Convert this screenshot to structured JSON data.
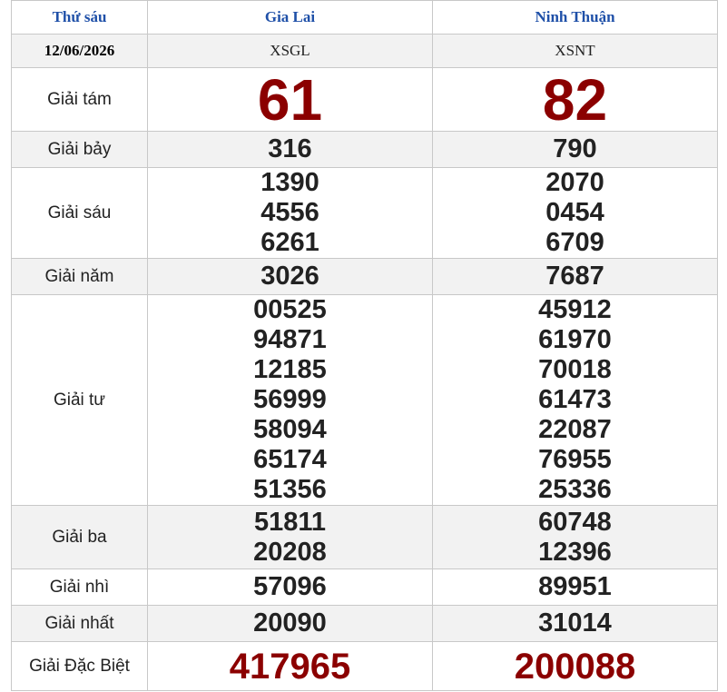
{
  "header": {
    "day": "Thứ sáu",
    "province_1": "Gia Lai",
    "province_2": "Ninh Thuận"
  },
  "subheader": {
    "date": "12/06/2026",
    "code_1": "XSGL",
    "code_2": "XSNT"
  },
  "prizes": [
    {
      "label": "Giải tám",
      "col1": [
        "61"
      ],
      "col2": [
        "82"
      ]
    },
    {
      "label": "Giải bảy",
      "col1": [
        "316"
      ],
      "col2": [
        "790"
      ]
    },
    {
      "label": "Giải sáu",
      "col1": [
        "1390",
        "4556",
        "6261"
      ],
      "col2": [
        "2070",
        "0454",
        "6709"
      ]
    },
    {
      "label": "Giải năm",
      "col1": [
        "3026"
      ],
      "col2": [
        "7687"
      ]
    },
    {
      "label": "Giải tư",
      "col1": [
        "00525",
        "94871",
        "12185",
        "56999",
        "58094",
        "65174",
        "51356"
      ],
      "col2": [
        "45912",
        "61970",
        "70018",
        "61473",
        "22087",
        "76955",
        "25336"
      ]
    },
    {
      "label": "Giải ba",
      "col1": [
        "51811",
        "20208"
      ],
      "col2": [
        "60748",
        "12396"
      ]
    },
    {
      "label": "Giải nhì",
      "col1": [
        "57096"
      ],
      "col2": [
        "89951"
      ]
    },
    {
      "label": "Giải nhất",
      "col1": [
        "20090"
      ],
      "col2": [
        "31014"
      ]
    },
    {
      "label": "Giải Đặc Biệt",
      "col1": [
        "417965"
      ],
      "col2": [
        "200088"
      ]
    }
  ],
  "colors": {
    "header_text": "#1f50a8",
    "highlight": "#8b0000",
    "alt_row": "#f2f2f2"
  }
}
